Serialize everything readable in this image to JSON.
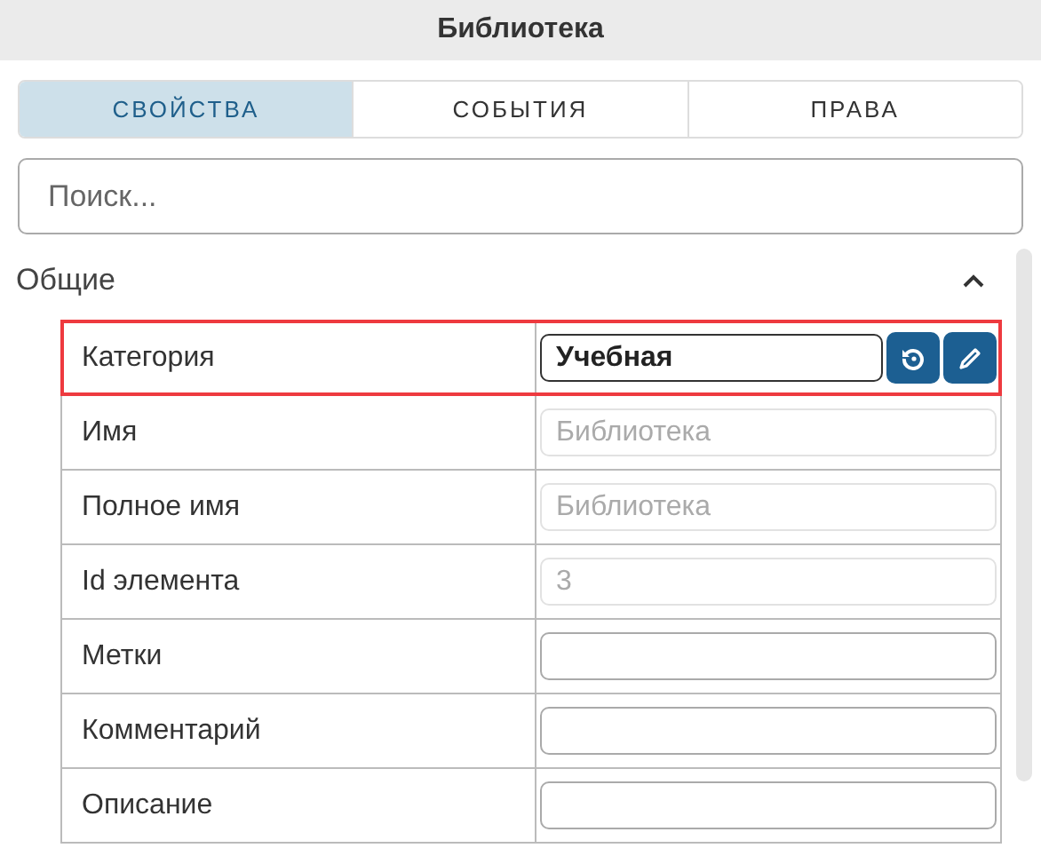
{
  "header": {
    "title": "Библиотека"
  },
  "tabs": [
    {
      "label": "СВОЙСТВА",
      "selected": true
    },
    {
      "label": "СОБЫТИЯ",
      "selected": false
    },
    {
      "label": "ПРАВА",
      "selected": false
    }
  ],
  "search": {
    "placeholder": "Поиск..."
  },
  "section": {
    "title": "Общие",
    "expanded": true,
    "rows": [
      {
        "label": "Категория",
        "value": "Учебная",
        "kind": "actions",
        "highlighted": true,
        "disabled": false
      },
      {
        "label": "Имя",
        "value": "Библиотека",
        "kind": "field",
        "highlighted": false,
        "disabled": true
      },
      {
        "label": "Полное имя",
        "value": "Библиотека",
        "kind": "field",
        "highlighted": false,
        "disabled": true
      },
      {
        "label": "Id элемента",
        "value": "3",
        "kind": "field",
        "highlighted": false,
        "disabled": true
      },
      {
        "label": "Метки",
        "kind": "field",
        "highlighted": false,
        "disabled": false
      },
      {
        "label": "Комментарий",
        "kind": "field",
        "highlighted": false,
        "disabled": false
      },
      {
        "label": "Описание",
        "kind": "field",
        "highlighted": false,
        "disabled": false
      }
    ]
  }
}
